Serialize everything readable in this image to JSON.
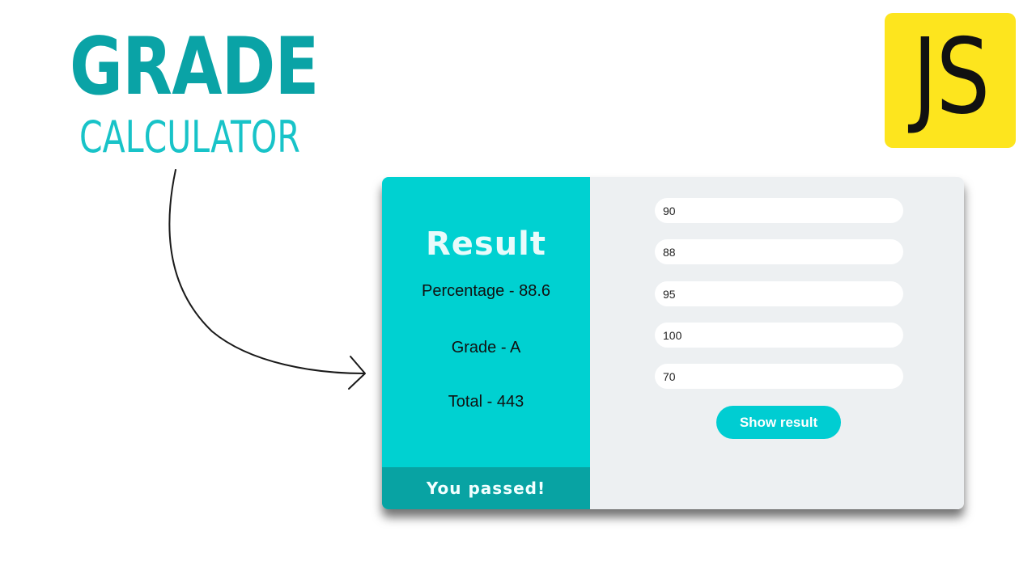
{
  "heading": {
    "title": "GRADE",
    "subtitle": "CALCULATOR"
  },
  "badge": {
    "label": "JS",
    "color": "#fde51e"
  },
  "result": {
    "heading": "Result",
    "percentage": "Percentage - 88.6",
    "grade": "Grade - A",
    "total": "Total - 443",
    "status": "You passed!"
  },
  "inputs": {
    "score_1": "90",
    "score_2": "88",
    "score_3": "95",
    "score_4": "100",
    "score_5": "70"
  },
  "actions": {
    "show_result_label": "Show result"
  },
  "colors": {
    "accent": "#00d1d1",
    "accent_dark": "#08a3a3",
    "heading_main": "#0aa3a6",
    "heading_sub": "#18c3c8",
    "panel_bg": "#edf0f2"
  },
  "icons": {
    "arrow": "curved-arrow-icon"
  }
}
